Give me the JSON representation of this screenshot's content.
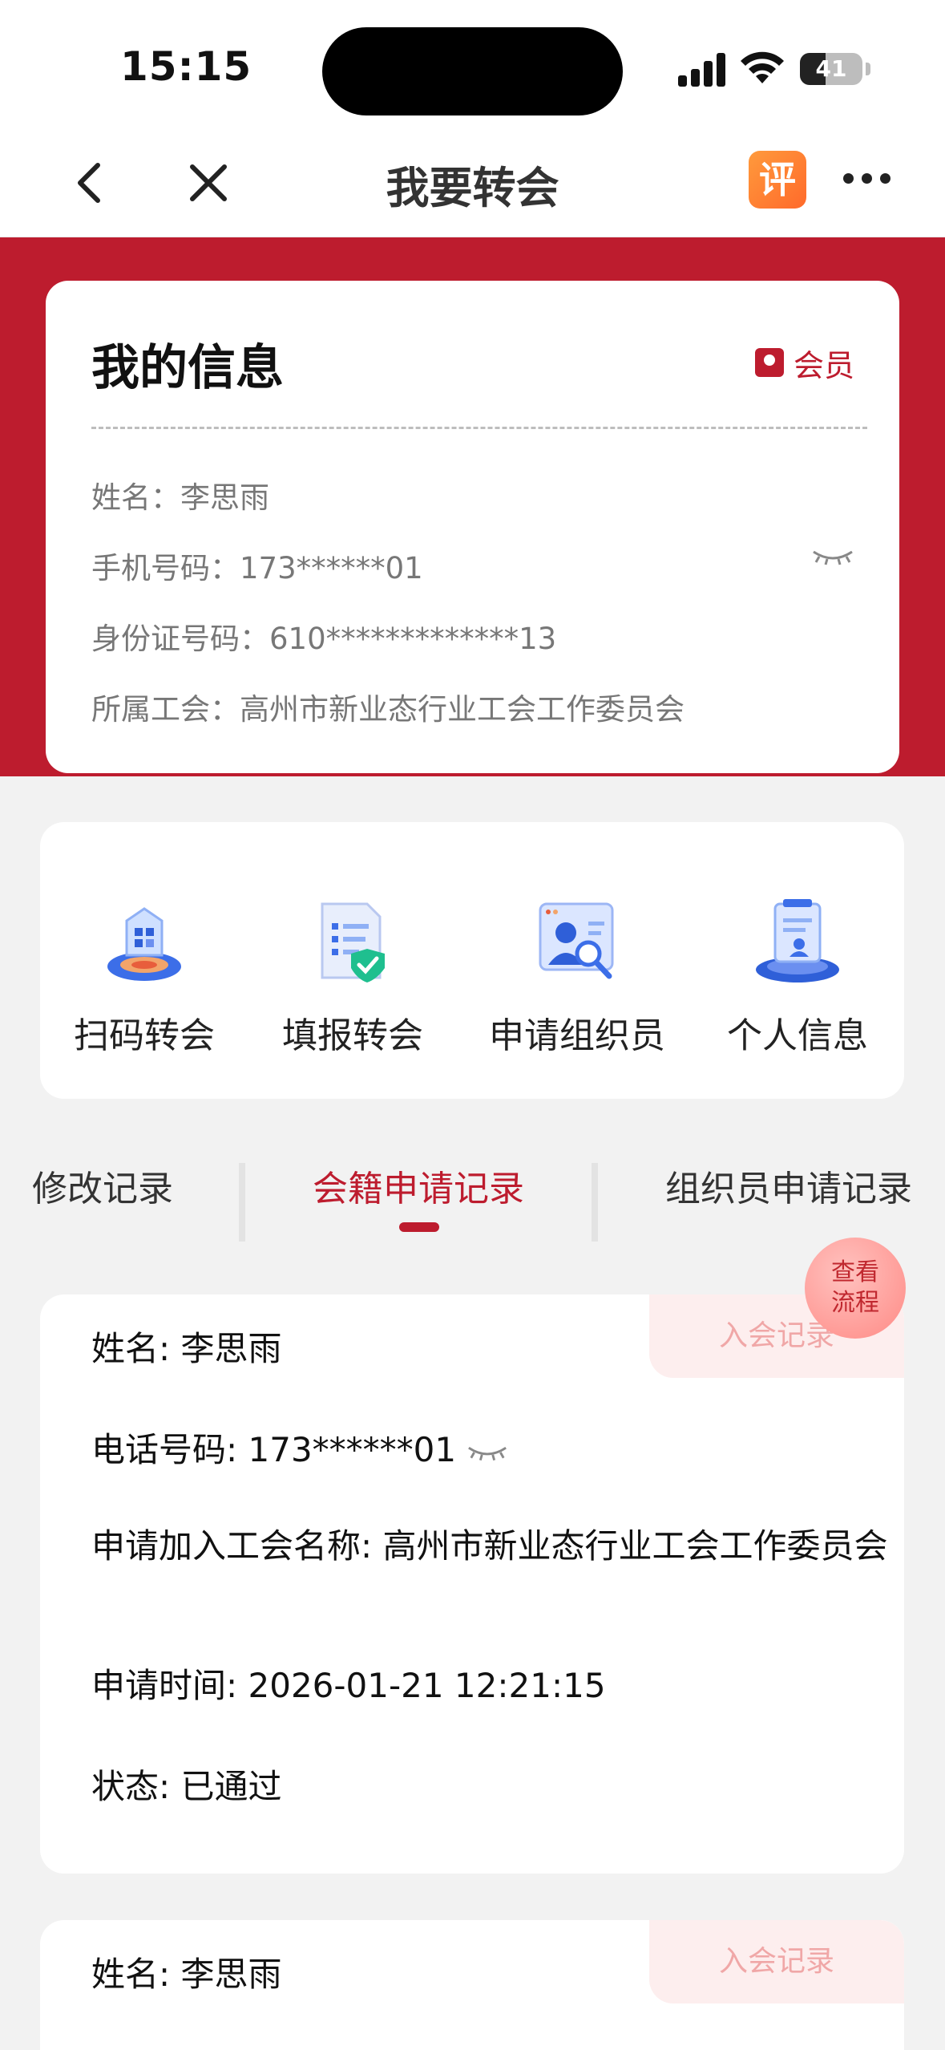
{
  "status_bar": {
    "time": "15:15",
    "battery": "41",
    "battery_level": 0.41
  },
  "nav": {
    "title": "我要转会",
    "rate_icon_label": "评"
  },
  "info_card": {
    "title": "我的信息",
    "badge": "会员",
    "rows": [
      {
        "label": "姓名：",
        "value": "李思雨"
      },
      {
        "label": "手机号码：",
        "value": "173******01"
      },
      {
        "label": "身份证号码：",
        "value": "610*************13"
      },
      {
        "label": "所属工会：",
        "value": "高州市新业态行业工会工作委员会"
      }
    ]
  },
  "actions": [
    {
      "label": "扫码转会",
      "icon": "scan-transfer-icon"
    },
    {
      "label": "填报转会",
      "icon": "form-transfer-icon"
    },
    {
      "label": "申请组织员",
      "icon": "apply-organizer-icon"
    },
    {
      "label": "个人信息",
      "icon": "personal-info-icon"
    }
  ],
  "tabs": [
    {
      "label": "修改记录",
      "active": false
    },
    {
      "label": "会籍申请记录",
      "active": true
    },
    {
      "label": "组织员申请记录",
      "active": false
    }
  ],
  "float_button": {
    "line1": "查看",
    "line2": "流程"
  },
  "records": [
    {
      "badge": "入会记录",
      "name": "姓名: 李思雨",
      "phone": "电话号码: 173******01",
      "union": "申请加入工会名称: 高州市新业态行业工会工作委员会",
      "time": "申请时间: 2026-01-21 12:21:15",
      "status": "状态: 已通过"
    },
    {
      "badge": "入会记录",
      "name": "姓名: 李思雨"
    }
  ],
  "colors": {
    "primary_red": "#bd1c2e",
    "badge_bg": "#fdeeee",
    "page_bg": "#f2f2f2"
  }
}
